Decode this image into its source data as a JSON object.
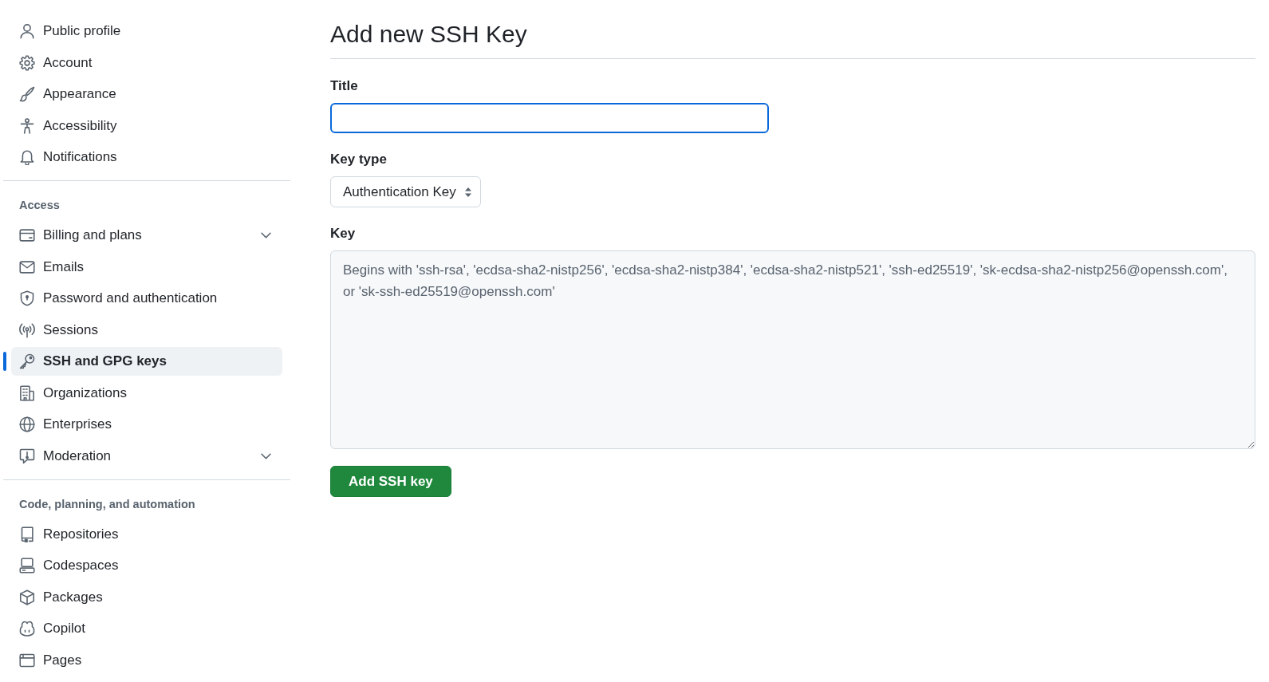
{
  "sidebar": {
    "sections": [
      {
        "items": [
          {
            "label": "Public profile",
            "kind": "link",
            "selected": false
          },
          {
            "label": "Account",
            "kind": "link",
            "selected": false
          },
          {
            "label": "Appearance",
            "kind": "link",
            "selected": false
          },
          {
            "label": "Accessibility",
            "kind": "link",
            "selected": false
          },
          {
            "label": "Notifications",
            "kind": "link",
            "selected": false
          }
        ]
      },
      {
        "heading": "Access",
        "items": [
          {
            "label": "Billing and plans",
            "kind": "collapsible",
            "expanded": false,
            "selected": false
          },
          {
            "label": "Emails",
            "kind": "link",
            "selected": false
          },
          {
            "label": "Password and authentication",
            "kind": "link",
            "selected": false
          },
          {
            "label": "Sessions",
            "kind": "link",
            "selected": false
          },
          {
            "label": "SSH and GPG keys",
            "kind": "link",
            "selected": true
          },
          {
            "label": "Organizations",
            "kind": "link",
            "selected": false
          },
          {
            "label": "Enterprises",
            "kind": "link",
            "selected": false
          },
          {
            "label": "Moderation",
            "kind": "collapsible",
            "expanded": false,
            "selected": false
          }
        ]
      },
      {
        "heading": "Code, planning, and automation",
        "items": [
          {
            "label": "Repositories",
            "kind": "link",
            "selected": false
          },
          {
            "label": "Codespaces",
            "kind": "link",
            "selected": false
          },
          {
            "label": "Packages",
            "kind": "link",
            "selected": false
          },
          {
            "label": "Copilot",
            "kind": "link",
            "selected": false
          },
          {
            "label": "Pages",
            "kind": "link",
            "selected": false
          }
        ]
      }
    ]
  },
  "main": {
    "heading": "Add new SSH Key",
    "fields": [
      {
        "kind": "text",
        "label": "Title",
        "focused": true
      },
      {
        "kind": "select",
        "label": "Key type",
        "value": "Authentication Key",
        "focused": false
      },
      {
        "kind": "textarea",
        "label": "Key",
        "placeholder": "Begins with 'ssh-rsa', 'ecdsa-sha2-nistp256', 'ecdsa-sha2-nistp384', 'ecdsa-sha2-nistp521', 'ssh-ed25519', 'sk-ecdsa-sha2-nistp256@openssh.com', or 'sk-ssh-ed25519@openssh.com'",
        "focused": false
      }
    ],
    "submit": {
      "label": "Add SSH key"
    }
  }
}
